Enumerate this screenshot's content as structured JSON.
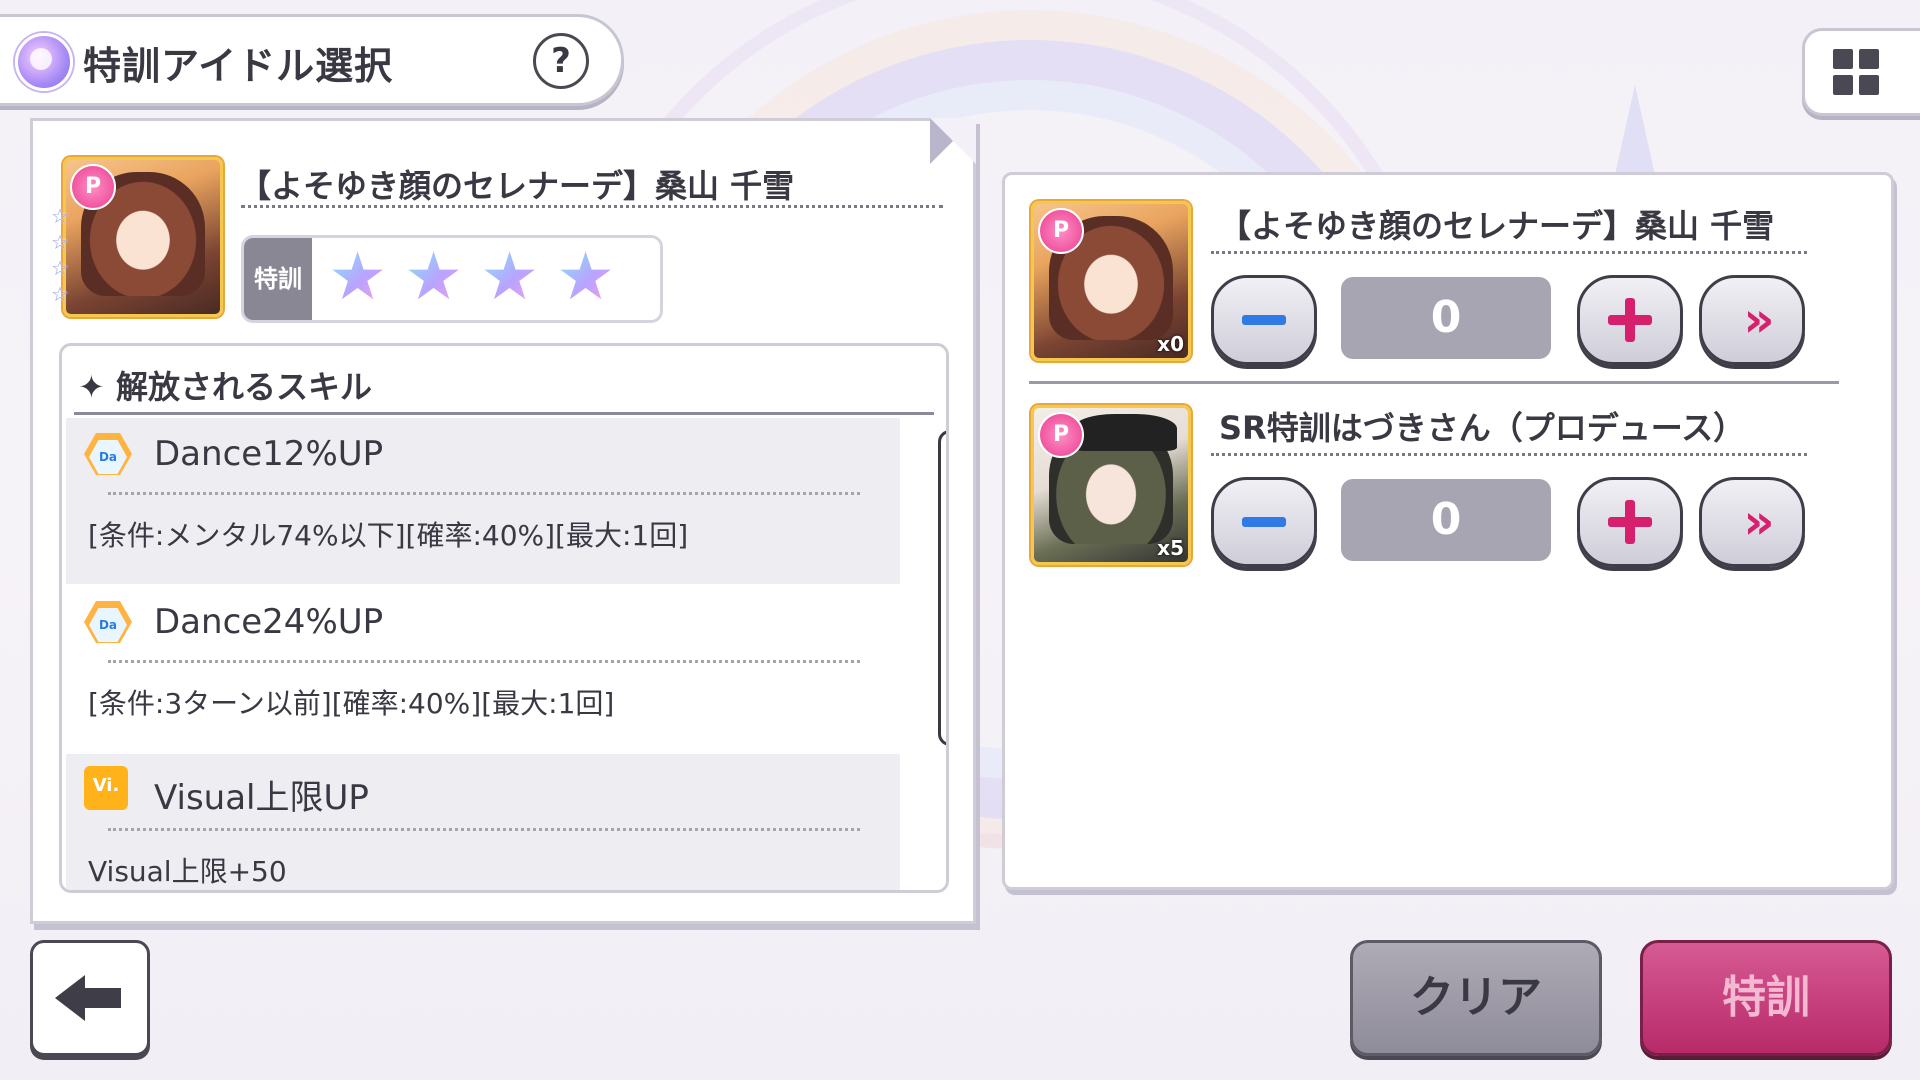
{
  "header": {
    "title": "特訓アイドル選択",
    "help_glyph": "?"
  },
  "selected_idol": {
    "card_badge": "P",
    "name": "【よそゆき顔のセレナーデ】桑山 千雪",
    "tokkun_label": "特訓",
    "stars": [
      "★",
      "★",
      "★",
      "★"
    ],
    "side_stars": [
      "☆",
      "☆",
      "☆",
      "☆"
    ]
  },
  "skills": {
    "heading": "✦ 解放されるスキル",
    "items": [
      {
        "icon": "dance-up-icon",
        "icon_text": "Da",
        "name": "Dance12%UP",
        "desc": "[条件:メンタル74%以下][確率:40%][最大:1回]"
      },
      {
        "icon": "dance-up-icon",
        "icon_text": "Da",
        "name": "Dance24%UP",
        "desc": "[条件:3ターン以前][確率:40%][最大:1回]"
      },
      {
        "icon": "visual-limit-up-icon",
        "icon_text": "Vi.",
        "name": "Visual上限UP",
        "desc": "Visual上限+50"
      }
    ]
  },
  "materials": [
    {
      "badge": "P",
      "name": "【よそゆき顔のセレナーデ】桑山 千雪",
      "owned": "x0",
      "value": "0"
    },
    {
      "badge": "P",
      "name": "SR特訓はづきさん（プロデュース）",
      "owned": "x5",
      "value": "0"
    }
  ],
  "buttons": {
    "clear": "クリア",
    "tokkun": "特訓"
  },
  "colors": {
    "accent_pink": "#d61f6d",
    "accent_blue": "#2f7ae5",
    "disabled_gray": "#a8a5b2"
  }
}
